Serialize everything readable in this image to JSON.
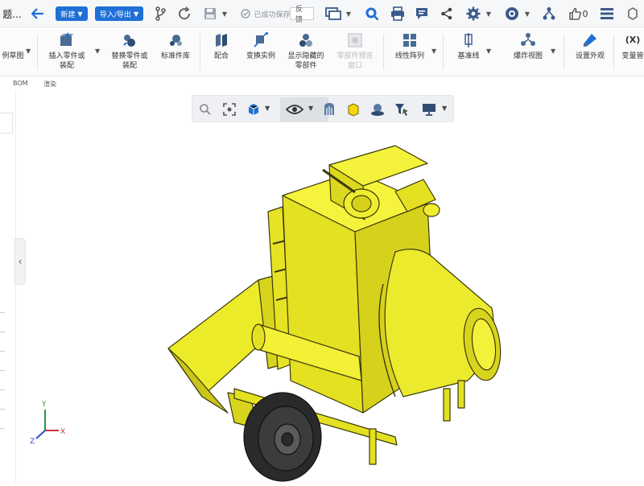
{
  "app": {
    "title_fragment": "题..."
  },
  "top_toolbar": {
    "new_label": "新建",
    "import_export_label": "导入/导出",
    "save_status": "已成功保存",
    "feedback_label": "反馈",
    "like_count": "0",
    "icons": [
      "back-arrow-icon",
      "branch-icon",
      "refresh-icon",
      "save-icon",
      "display-icon",
      "search-icon",
      "print-icon",
      "comment-icon",
      "share-icon",
      "settings-icon",
      "help-icon",
      "tree-icon",
      "like-icon",
      "menu-icon"
    ]
  },
  "ribbon": {
    "items": [
      {
        "name": "sketch-partial",
        "label": "例草图"
      },
      {
        "name": "insert-part",
        "label": "插入零件或\n装配"
      },
      {
        "name": "replace-part",
        "label": "替换零件或\n装配"
      },
      {
        "name": "standard-parts",
        "label": "标准件库"
      },
      {
        "name": "mate",
        "label": "配合"
      },
      {
        "name": "transform-instance",
        "label": "变换实例"
      },
      {
        "name": "show-hidden",
        "label": "显示隐藏的\n零部件"
      },
      {
        "name": "part-preview",
        "label": "零部件预览\n窗口"
      },
      {
        "name": "linear-pattern",
        "label": "线性阵列"
      },
      {
        "name": "datum-line",
        "label": "基准线"
      },
      {
        "name": "exploded-view",
        "label": "爆炸视图"
      },
      {
        "name": "appearance",
        "label": "设置外观"
      },
      {
        "name": "variables",
        "label": "变量管"
      }
    ],
    "variables_icon_text": "(X)"
  },
  "subtabs": {
    "bom": "BOM",
    "render": "渲染"
  },
  "view_toolbar": {
    "icons": [
      "zoom-icon",
      "fit-view-icon",
      "view-cube-icon",
      "visibility-eye-icon",
      "section-view-icon",
      "shaded-mode-icon",
      "render-icon",
      "filter-select-icon",
      "display-monitor-icon"
    ]
  },
  "triad": {
    "x": "X",
    "y": "Y",
    "z": "Z"
  },
  "colors": {
    "accent": "#1f6fd6",
    "model": "#f2ef1a",
    "model_edge": "#3b3a0a",
    "wheel": "#2a2a2a"
  }
}
